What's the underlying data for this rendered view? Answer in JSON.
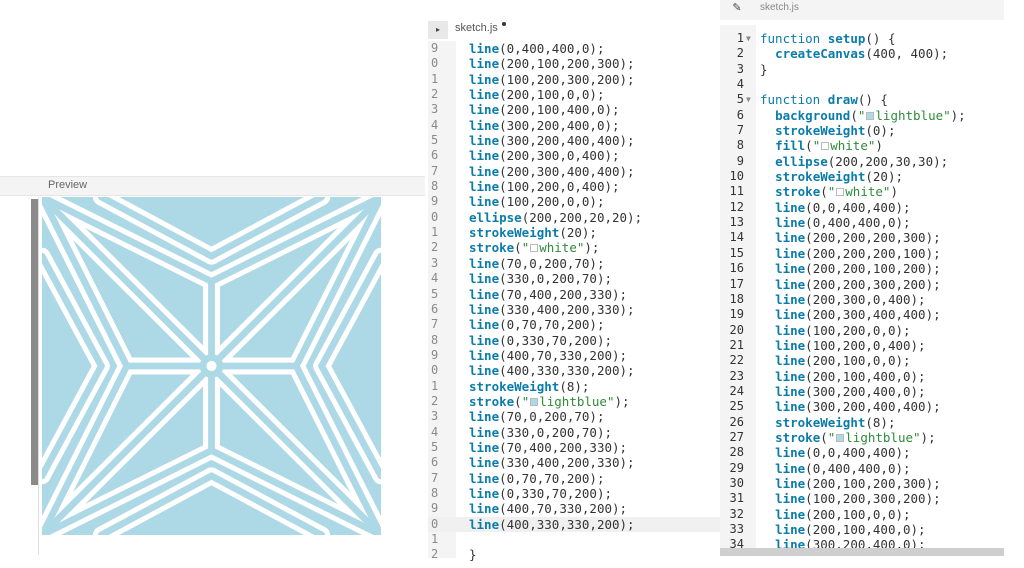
{
  "preview": {
    "label": "Preview",
    "background_color": "#add8e6",
    "stroke_color": "#ffffff"
  },
  "editor_left": {
    "tab_name": "sketch.js",
    "tab_icon": "collapse-arrow-icon",
    "lines": [
      {
        "n": "9",
        "code": "line(0,400,400,0);"
      },
      {
        "n": "0",
        "code": "line(200,100,200,300);"
      },
      {
        "n": "1",
        "code": "line(100,200,300,200);"
      },
      {
        "n": "2",
        "code": "line(200,100,0,0);"
      },
      {
        "n": "3",
        "code": "line(200,100,400,0);"
      },
      {
        "n": "4",
        "code": "line(300,200,400,0);"
      },
      {
        "n": "5",
        "code": "line(300,200,400,400);"
      },
      {
        "n": "6",
        "code": "line(200,300,0,400);"
      },
      {
        "n": "7",
        "code": "line(200,300,400,400);"
      },
      {
        "n": "8",
        "code": "line(100,200,0,400);"
      },
      {
        "n": "9",
        "code": "line(100,200,0,0);"
      },
      {
        "n": "0",
        "code": "ellipse(200,200,20,20);"
      },
      {
        "n": "1",
        "code": "strokeWeight(20);"
      },
      {
        "n": "2",
        "code": "stroke(\"□white\");"
      },
      {
        "n": "3",
        "code": "line(70,0,200,70);"
      },
      {
        "n": "4",
        "code": "line(330,0,200,70);"
      },
      {
        "n": "5",
        "code": "line(70,400,200,330);"
      },
      {
        "n": "6",
        "code": "line(330,400,200,330);"
      },
      {
        "n": "7",
        "code": "line(0,70,70,200);"
      },
      {
        "n": "8",
        "code": "line(0,330,70,200);"
      },
      {
        "n": "9",
        "code": "line(400,70,330,200);"
      },
      {
        "n": "0",
        "code": "line(400,330,330,200);"
      },
      {
        "n": "1",
        "code": "strokeWeight(8);"
      },
      {
        "n": "2",
        "code": "stroke(\"■lightblue\");"
      },
      {
        "n": "3",
        "code": "line(70,0,200,70);"
      },
      {
        "n": "4",
        "code": "line(330,0,200,70);"
      },
      {
        "n": "5",
        "code": "line(70,400,200,330);"
      },
      {
        "n": "6",
        "code": "line(330,400,200,330);"
      },
      {
        "n": "7",
        "code": "line(0,70,70,200);"
      },
      {
        "n": "8",
        "code": "line(0,330,70,200);"
      },
      {
        "n": "9",
        "code": "line(400,70,330,200);"
      },
      {
        "n": "0",
        "code": "line(400,330,330,200);"
      },
      {
        "n": "1",
        "code": ""
      },
      {
        "n": "2",
        "code": "}"
      }
    ]
  },
  "editor_right": {
    "tab_name": "sketch.js",
    "tab_icon": "pencil-icon",
    "lines": [
      {
        "n": "1",
        "fold": "▼",
        "code": "function setup() {"
      },
      {
        "n": "2",
        "fold": "",
        "code": "  createCanvas(400, 400);"
      },
      {
        "n": "3",
        "fold": "",
        "code": "}"
      },
      {
        "n": "4",
        "fold": "",
        "code": ""
      },
      {
        "n": "5",
        "fold": "▼",
        "code": "function draw() {"
      },
      {
        "n": "6",
        "fold": "",
        "code": "  background(\"■lightblue\");"
      },
      {
        "n": "7",
        "fold": "",
        "code": "  strokeWeight(0);"
      },
      {
        "n": "8",
        "fold": "",
        "code": "  fill(\"□white\")"
      },
      {
        "n": "9",
        "fold": "",
        "code": "  ellipse(200,200,30,30);"
      },
      {
        "n": "10",
        "fold": "",
        "code": "  strokeWeight(20);"
      },
      {
        "n": "11",
        "fold": "",
        "code": "  stroke(\"□white\")"
      },
      {
        "n": "12",
        "fold": "",
        "code": "  line(0,0,400,400);"
      },
      {
        "n": "13",
        "fold": "",
        "code": "  line(0,400,400,0);"
      },
      {
        "n": "14",
        "fold": "",
        "code": "  line(200,200,200,300);"
      },
      {
        "n": "15",
        "fold": "",
        "code": "  line(200,200,200,100);"
      },
      {
        "n": "16",
        "fold": "",
        "code": "  line(200,200,100,200);"
      },
      {
        "n": "17",
        "fold": "",
        "code": "  line(200,200,300,200);"
      },
      {
        "n": "18",
        "fold": "",
        "code": "  line(200,300,0,400);"
      },
      {
        "n": "19",
        "fold": "",
        "code": "  line(200,300,400,400);"
      },
      {
        "n": "20",
        "fold": "",
        "code": "  line(100,200,0,0);"
      },
      {
        "n": "21",
        "fold": "",
        "code": "  line(100,200,0,400);"
      },
      {
        "n": "22",
        "fold": "",
        "code": "  line(200,100,0,0);"
      },
      {
        "n": "23",
        "fold": "",
        "code": "  line(200,100,400,0);"
      },
      {
        "n": "24",
        "fold": "",
        "code": "  line(300,200,400,0);"
      },
      {
        "n": "25",
        "fold": "",
        "code": "  line(300,200,400,400);"
      },
      {
        "n": "26",
        "fold": "",
        "code": "  strokeWeight(8);"
      },
      {
        "n": "27",
        "fold": "",
        "code": "  stroke(\"■lightblue\");"
      },
      {
        "n": "28",
        "fold": "",
        "code": "  line(0,0,400,400);"
      },
      {
        "n": "29",
        "fold": "",
        "code": "  line(0,400,400,0);"
      },
      {
        "n": "30",
        "fold": "",
        "code": "  line(200,100,200,300);"
      },
      {
        "n": "31",
        "fold": "",
        "code": "  line(100,200,300,200);"
      },
      {
        "n": "32",
        "fold": "",
        "code": "  line(200,100,0,0);"
      },
      {
        "n": "33",
        "fold": "",
        "code": "  line(200,100,400,0);"
      },
      {
        "n": "34",
        "fold": "",
        "code": "  line(300,200,400,0);"
      }
    ]
  }
}
